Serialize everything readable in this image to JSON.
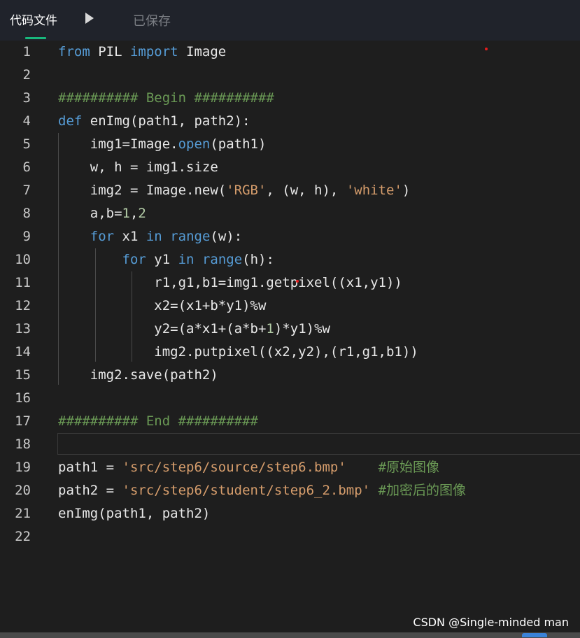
{
  "header": {
    "tab_label": "代码文件",
    "run_icon": "play-icon",
    "status": "已保存"
  },
  "watermark": "CSDN @Single-minded man",
  "colors": {
    "accent": "#18b77d",
    "keyword": "#569cd6",
    "string": "#d69d6c",
    "comment": "#6a9955",
    "number": "#b5cea8"
  },
  "code": {
    "line_numbers": [
      "1",
      "2",
      "3",
      "4",
      "5",
      "6",
      "7",
      "8",
      "9",
      "10",
      "11",
      "12",
      "13",
      "14",
      "15",
      "16",
      "17",
      "18",
      "19",
      "20",
      "21",
      "22"
    ],
    "lines": [
      [
        {
          "t": "from",
          "c": "kw"
        },
        {
          "t": " PIL "
        },
        {
          "t": "import",
          "c": "kw"
        },
        {
          "t": " Image"
        }
      ],
      [],
      [
        {
          "t": "########## Begin ##########",
          "c": "cmt"
        }
      ],
      [
        {
          "t": "def",
          "c": "kw"
        },
        {
          "t": " enImg(path1, path2):"
        }
      ],
      [
        {
          "t": "    img1=Image."
        },
        {
          "t": "open",
          "c": "fn"
        },
        {
          "t": "(path1)"
        }
      ],
      [
        {
          "t": "    w, h = img1.size"
        }
      ],
      [
        {
          "t": "    img2 = Image.new("
        },
        {
          "t": "'RGB'",
          "c": "str"
        },
        {
          "t": ", (w, h), "
        },
        {
          "t": "'white'",
          "c": "str"
        },
        {
          "t": ")"
        }
      ],
      [
        {
          "t": "    a,b="
        },
        {
          "t": "1",
          "c": "num"
        },
        {
          "t": ","
        },
        {
          "t": "2",
          "c": "num"
        }
      ],
      [
        {
          "t": "    "
        },
        {
          "t": "for",
          "c": "kw"
        },
        {
          "t": " x1 "
        },
        {
          "t": "in",
          "c": "kw"
        },
        {
          "t": " "
        },
        {
          "t": "range",
          "c": "fn"
        },
        {
          "t": "(w):"
        }
      ],
      [
        {
          "t": "        "
        },
        {
          "t": "for",
          "c": "kw"
        },
        {
          "t": " y1 "
        },
        {
          "t": "in",
          "c": "kw"
        },
        {
          "t": " "
        },
        {
          "t": "range",
          "c": "fn"
        },
        {
          "t": "(h):"
        }
      ],
      [
        {
          "t": "            r1,g1,b1=img1.getpixel((x1,y1))"
        }
      ],
      [
        {
          "t": "            x2=(x1+b*y1)%w"
        }
      ],
      [
        {
          "t": "            y2=(a*x1+(a*b+"
        },
        {
          "t": "1",
          "c": "num"
        },
        {
          "t": ")*y1)%w"
        }
      ],
      [
        {
          "t": "            img2.putpixel((x2,y2),(r1,g1,b1))"
        }
      ],
      [
        {
          "t": "    img2.save(path2)"
        }
      ],
      [],
      [
        {
          "t": "########## End ##########",
          "c": "cmt"
        }
      ],
      [],
      [
        {
          "t": "path1 = "
        },
        {
          "t": "'src/step6/source/step6.bmp'",
          "c": "str"
        },
        {
          "t": "    "
        },
        {
          "t": "#原始图像",
          "c": "cmt"
        }
      ],
      [
        {
          "t": "path2 = "
        },
        {
          "t": "'src/step6/student/step6_2.bmp'",
          "c": "str"
        },
        {
          "t": " "
        },
        {
          "t": "#加密后的图像",
          "c": "cmt"
        }
      ],
      [
        {
          "t": "enImg(path1, path2)"
        }
      ],
      []
    ]
  }
}
